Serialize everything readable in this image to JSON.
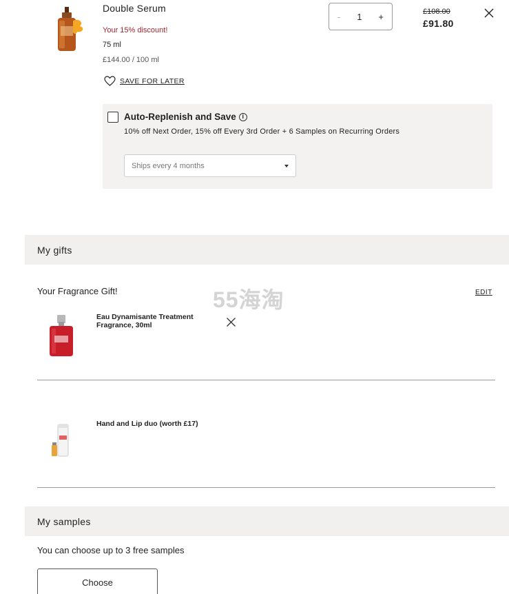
{
  "product": {
    "name": "Double Serum",
    "discount": "Your 15% discount!",
    "size": "75 ml",
    "unit_price": "£144.00 / 100 ml",
    "save_later": "SAVE FOR LATER",
    "quantity": "1",
    "qty_minus": "-",
    "qty_plus": "+",
    "price_old": "£108.00",
    "price_new": "£91.80",
    "image_icon": "serum-bottle-icon"
  },
  "replenish": {
    "title": "Auto-Replenish and Save",
    "info_glyph": "i",
    "description": "10% off Next Order, 15% off Every 3rd Order + 6 Samples on Recurring Orders",
    "selected_frequency": "Ships every 4 months",
    "checked": false
  },
  "gifts": {
    "header": "My gifts",
    "fragrance_title": "Your Fragrance Gift!",
    "edit": "EDIT",
    "items": [
      {
        "name": "Eau Dynamisante Treatment Fragrance, 30ml",
        "image_icon": "fragrance-bottle-icon"
      },
      {
        "name": "Hand and Lip duo (worth £17)",
        "image_icon": "hand-lip-duo-icon"
      }
    ]
  },
  "watermark": "55海淘",
  "samples": {
    "header": "My samples",
    "text": "You can choose up to 3 free samples",
    "choose": "Choose"
  },
  "colors": {
    "discount_red": "#a5242b",
    "section_bg": "#f2f0ee",
    "replenish_bg": "#f4f2f0"
  }
}
